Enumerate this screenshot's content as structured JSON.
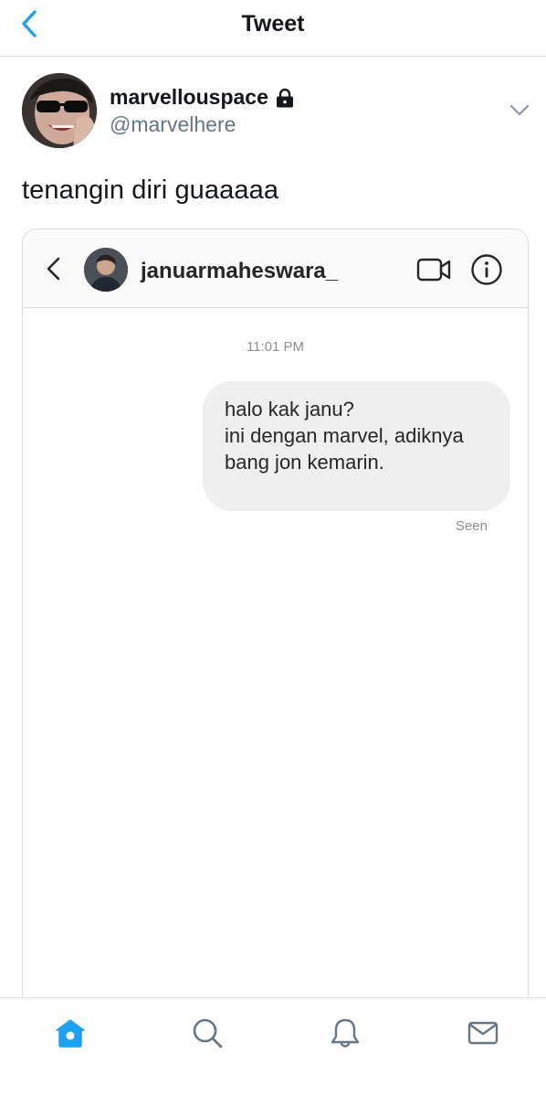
{
  "header": {
    "title": "Tweet",
    "back_icon": "chevron-left-icon",
    "accent_color": "#1da1f2"
  },
  "tweet": {
    "display_name": "marvellouspace",
    "handle": "@marvelhere",
    "protected_icon": "lock-icon",
    "text": "tenangin diri guaaaaa",
    "menu_icon": "chevron-down-icon"
  },
  "embedded_dm": {
    "username": "januarmaheswara_",
    "timestamp": "11:01 PM",
    "message_lines": [
      "halo kak janu?",
      "ini dengan marvel, adiknya",
      "bang jon kemarin."
    ],
    "status": "Seen",
    "icons": [
      "chevron-left-icon",
      "video-camera-icon",
      "info-icon"
    ]
  },
  "tabbar": {
    "tabs": [
      {
        "icon": "home-icon",
        "active": true
      },
      {
        "icon": "search-icon",
        "active": false
      },
      {
        "icon": "bell-icon",
        "active": false
      },
      {
        "icon": "mail-icon",
        "active": false
      }
    ],
    "active_color": "#1da1f2",
    "inactive_color": "#657786"
  }
}
